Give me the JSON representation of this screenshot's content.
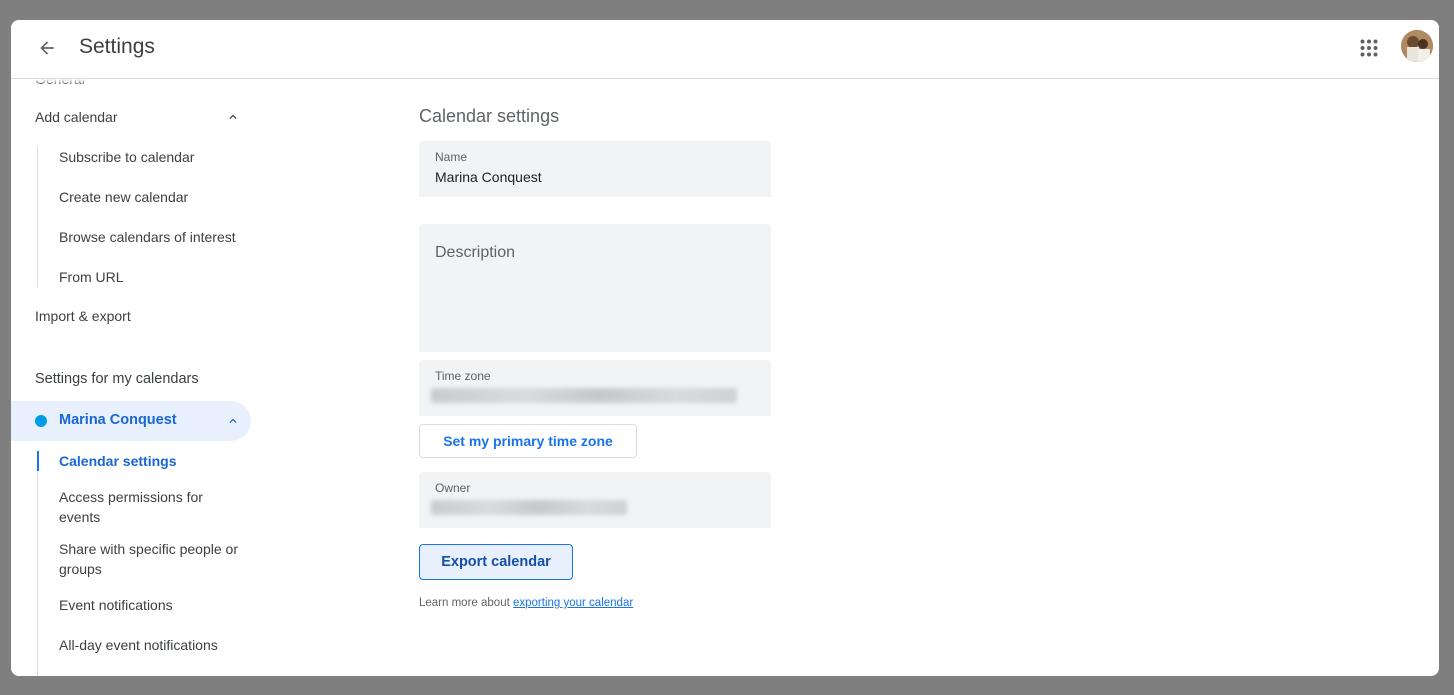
{
  "header": {
    "title": "Settings",
    "back_icon": "arrow-back-icon",
    "apps_icon": "apps-grid-icon",
    "avatar": "user-avatar"
  },
  "sidebar": {
    "general_label": "General",
    "add_calendar": {
      "label": "Add calendar",
      "expanded": true,
      "items": [
        "Subscribe to calendar",
        "Create new calendar",
        "Browse calendars of interest",
        "From URL"
      ]
    },
    "import_export": "Import & export",
    "section_title": "Settings for my calendars",
    "calendar": {
      "name": "Marina Conquest",
      "color": "#039be5",
      "expanded": true,
      "items": [
        "Calendar settings",
        "Access permissions for events",
        "Share with specific people or groups",
        "Event notifications",
        "All-day event notifications"
      ],
      "active_index": 0
    }
  },
  "main": {
    "section_title": "Calendar settings",
    "name_field": {
      "label": "Name",
      "value": "Marina Conquest"
    },
    "description_field": {
      "placeholder": "Description",
      "value": ""
    },
    "timezone_field": {
      "label": "Time zone"
    },
    "primary_tz_button": "Set my primary time zone",
    "owner_field": {
      "label": "Owner"
    },
    "export_button": "Export calendar",
    "learn_more_prefix": "Learn more about ",
    "learn_more_link": "exporting your calendar"
  },
  "colors": {
    "accent": "#1a73e8",
    "active_bg": "#e8f0fe",
    "field_bg": "#f1f3f4"
  }
}
